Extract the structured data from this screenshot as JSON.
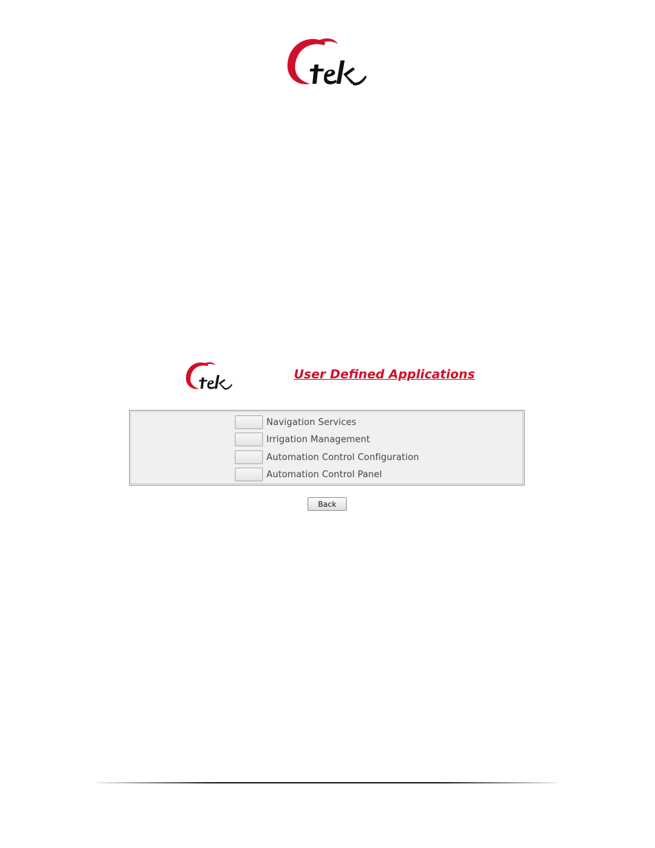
{
  "brand": {
    "logo_text": "Ctek",
    "logo_color": "#d0102a",
    "logo_accent_color": "#111111"
  },
  "header": {
    "title": "User Defined Applications",
    "title_color": "#d0102a"
  },
  "applications": [
    {
      "label": "Navigation Services"
    },
    {
      "label": "Irrigation Management"
    },
    {
      "label": "Automation Control Configuration"
    },
    {
      "label": "Automation Control Panel"
    }
  ],
  "actions": {
    "back_label": "Back"
  }
}
